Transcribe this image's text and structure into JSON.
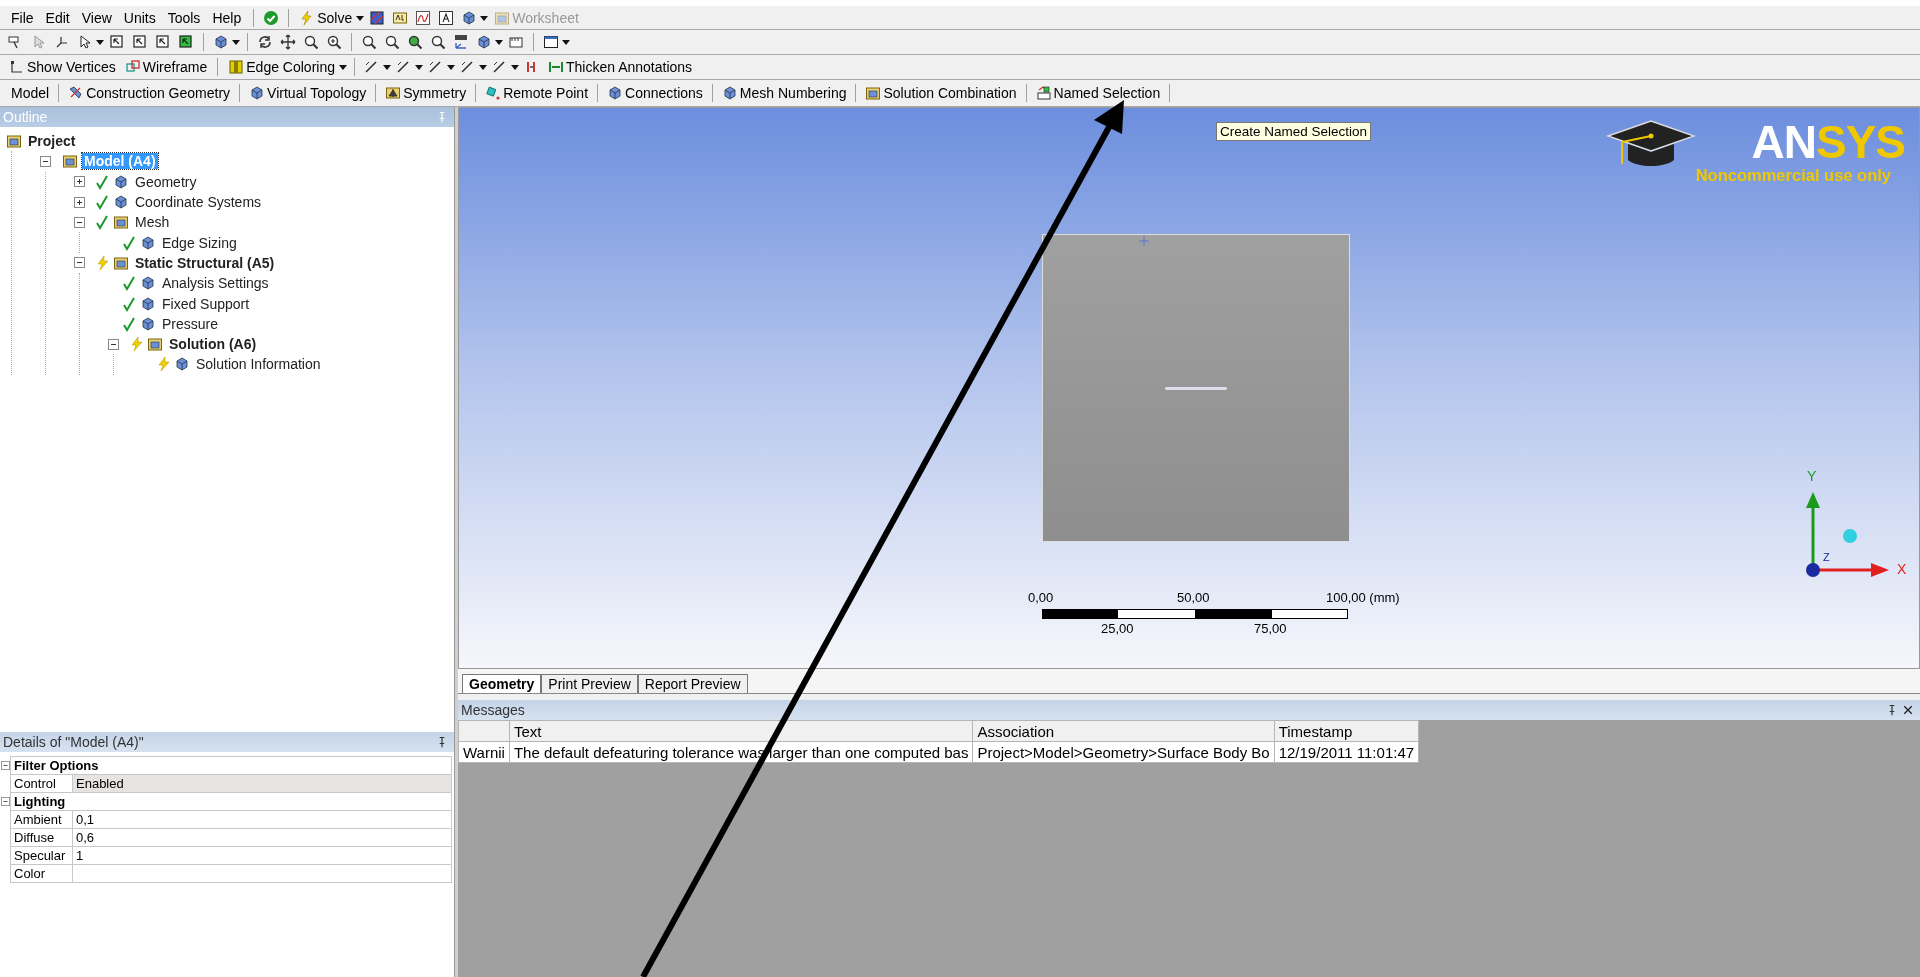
{
  "menu": [
    "File",
    "Edit",
    "View",
    "Units",
    "Tools",
    "Help"
  ],
  "standard_toolbar": [
    {
      "label": "Solve",
      "dropdown": true,
      "disabled": false
    },
    {
      "label": "Worksheet",
      "dropdown": false,
      "disabled": true
    }
  ],
  "graphics_toolbar": [
    {
      "label": "Show Vertices",
      "dropdown": false
    },
    {
      "label": "Wireframe",
      "dropdown": false
    },
    {
      "label": "Edge Coloring",
      "dropdown": true
    },
    {
      "label": "Thicken Annotations",
      "dropdown": false
    }
  ],
  "context_toolbar": [
    "Model",
    "Construction Geometry",
    "Virtual Topology",
    "Symmetry",
    "Remote Point",
    "Connections",
    "Mesh Numbering",
    "Solution Combination",
    "Named Selection"
  ],
  "outline": {
    "title": "Outline",
    "tree": [
      {
        "label": "Project",
        "bold": true,
        "selected": false,
        "children": [
          {
            "label": "Model (A4)",
            "bold": true,
            "selected": true,
            "expanded": true,
            "children": [
              {
                "label": "Geometry",
                "bold": false,
                "selected": false,
                "up_to_date": true,
                "expanded": false
              },
              {
                "label": "Coordinate Systems",
                "bold": false,
                "selected": false,
                "up_to_date": true,
                "expanded": false
              },
              {
                "label": "Mesh",
                "bold": false,
                "selected": false,
                "up_to_date": true,
                "expanded": true,
                "children": [
                  {
                    "label": "Edge Sizing",
                    "bold": false,
                    "selected": false,
                    "up_to_date": true
                  }
                ]
              },
              {
                "label": "Static Structural (A5)",
                "bold": true,
                "selected": false,
                "up_to_date": false,
                "expanded": true,
                "children": [
                  {
                    "label": "Analysis Settings",
                    "bold": false,
                    "selected": false,
                    "up_to_date": true
                  },
                  {
                    "label": "Fixed Support",
                    "bold": false,
                    "selected": false,
                    "up_to_date": true
                  },
                  {
                    "label": "Pressure",
                    "bold": false,
                    "selected": false,
                    "up_to_date": true
                  },
                  {
                    "label": "Solution (A6)",
                    "bold": true,
                    "selected": false,
                    "up_to_date": false,
                    "expanded": true,
                    "children": [
                      {
                        "label": "Solution Information",
                        "bold": false,
                        "selected": false,
                        "up_to_date": false
                      }
                    ]
                  }
                ]
              }
            ]
          }
        ]
      }
    ]
  },
  "details": {
    "title": "Details of \"Model (A4)\"",
    "groups": [
      {
        "name": "Filter Options",
        "expanded": true,
        "rows": [
          {
            "label": "Control",
            "value": "Enabled",
            "shaded": true
          }
        ]
      },
      {
        "name": "Lighting",
        "expanded": true,
        "rows": [
          {
            "label": "Ambient",
            "value": "0,1",
            "shaded": false
          },
          {
            "label": "Diffuse",
            "value": "0,6",
            "shaded": false
          },
          {
            "label": "Specular",
            "value": "1",
            "shaded": false
          },
          {
            "label": "Color",
            "shaded": false
          }
        ]
      }
    ]
  },
  "viewport": {
    "tooltip": "Create Named Selection",
    "logo": {
      "wordmark": [
        "AN",
        "SYS"
      ],
      "caption": "Noncommercial use only"
    },
    "scale_bar": {
      "top_labels": [
        "0,00",
        "50,00",
        "100,00 (mm)"
      ],
      "bottom_labels": [
        "25,00",
        "75,00"
      ]
    },
    "triad": {
      "y": "Y",
      "x": "X",
      "z": "Z"
    }
  },
  "view_tabs": [
    {
      "label": "Geometry",
      "selected": true
    },
    {
      "label": "Print Preview",
      "selected": false
    },
    {
      "label": "Report Preview",
      "selected": false
    }
  ],
  "messages": {
    "title": "Messages",
    "columns": [
      "",
      "Text",
      "Association",
      "Timestamp"
    ],
    "rows": [
      [
        "Warnii",
        "The default defeaturing tolerance was larger than one computed bas",
        "Project>Model>Geometry>Surface Body Bo",
        "12/19/2011 11:01:47"
      ]
    ]
  }
}
